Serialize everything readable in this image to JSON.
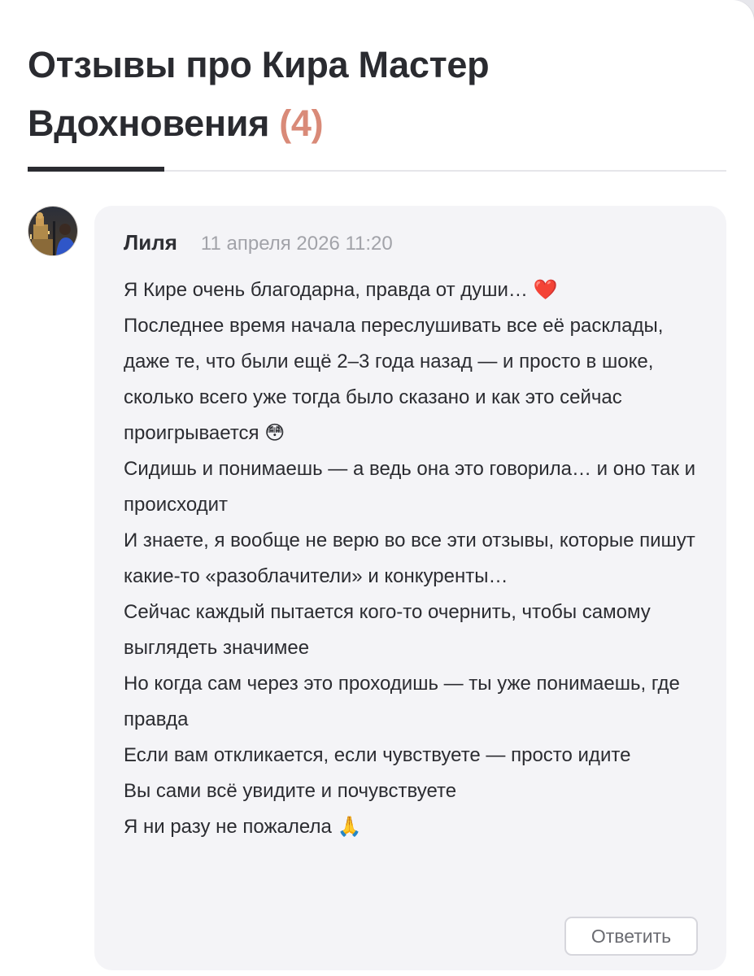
{
  "reviews_section": {
    "title": "Отзывы про Кира Мастер Вдохновения",
    "count": "(4)"
  },
  "review": {
    "author": "Лиля",
    "date": "11 апреля 2026 11:20",
    "text": "Я Кире очень благодарна, правда от души… ❤️\nПоследнее время начала переслушивать все её расклады, даже те, что были ещё 2–3 года назад — и просто в шоке, сколько всего уже тогда было сказано и как это сейчас проигрывается 😳\nСидишь и понимаешь — а ведь она это говорила… и оно так и происходит\nИ знаете, я вообще не верю во все эти отзывы, которые пишут какие-то «разоблачители» и конкуренты…\nСейчас каждый пытается кого-то очернить, чтобы самому выглядеть значимее\nНо когда сам через это проходишь — ты уже понимаешь, где правда\nЕсли вам откликается, если чувствуете — просто идите\nВы сами всё увидите и почувствуете\nЯ ни разу не пожалела 🙏",
    "reply_label": "Ответить"
  },
  "colors": {
    "title": "#2a2b30",
    "count": "#d98a78",
    "card_background": "#f4f4f7",
    "date": "#a2a3a9"
  }
}
